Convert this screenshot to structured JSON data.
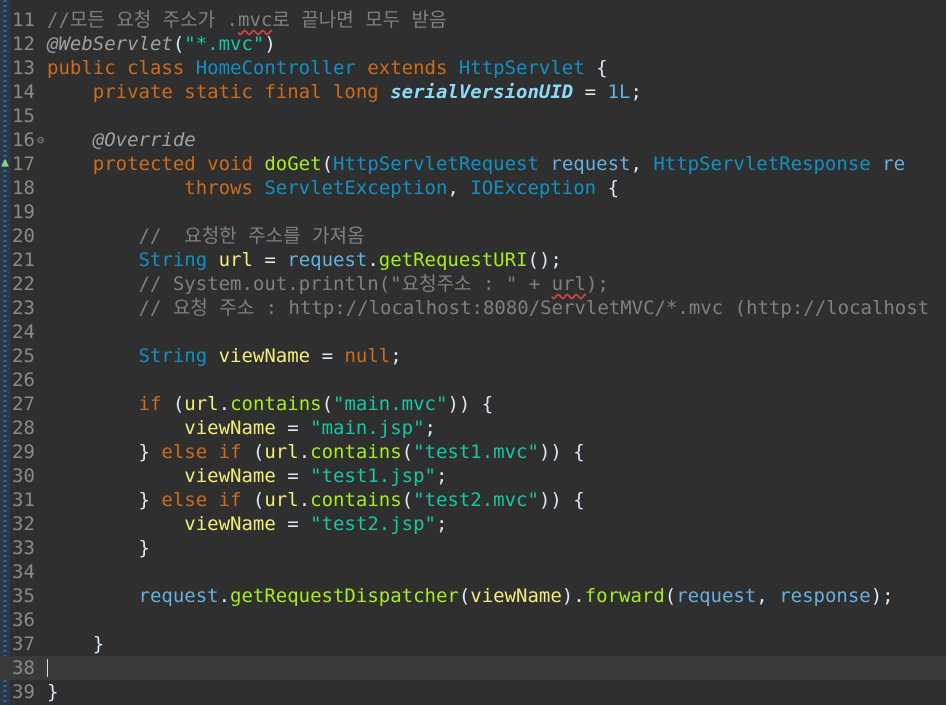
{
  "editor": {
    "lines": [
      {
        "n": "11",
        "tokens": [
          {
            "c": "c",
            "t": "//모든 요청 주소가 ."
          },
          {
            "c": "c sq",
            "t": "mvc"
          },
          {
            "c": "c",
            "t": "로 끝나면 모두 받음"
          }
        ]
      },
      {
        "n": "12",
        "tokens": [
          {
            "c": "an",
            "t": "@WebServlet"
          },
          {
            "c": "w",
            "t": "("
          },
          {
            "c": "s",
            "t": "\"*.mvc\""
          },
          {
            "c": "w",
            "t": ")"
          }
        ]
      },
      {
        "n": "13",
        "tokens": [
          {
            "c": "k",
            "t": "public class "
          },
          {
            "c": "t",
            "t": "HomeController"
          },
          {
            "c": "k",
            "t": " extends "
          },
          {
            "c": "t",
            "t": "HttpServlet"
          },
          {
            "c": "w",
            "t": " {"
          }
        ]
      },
      {
        "n": "14",
        "tokens": [
          {
            "c": "w",
            "t": "    "
          },
          {
            "c": "k",
            "t": "private static final long "
          },
          {
            "c": "fi",
            "t": "serialVersionUID"
          },
          {
            "c": "w",
            "t": " = "
          },
          {
            "c": "p",
            "t": "1L"
          },
          {
            "c": "w",
            "t": ";"
          }
        ]
      },
      {
        "n": "15",
        "tokens": []
      },
      {
        "n": "16",
        "fold": "⊖",
        "tokens": [
          {
            "c": "w",
            "t": "    "
          },
          {
            "c": "an",
            "t": "@Override"
          }
        ]
      },
      {
        "n": "17",
        "tokens": [
          {
            "c": "w",
            "t": "    "
          },
          {
            "c": "k",
            "t": "protected void "
          },
          {
            "c": "m",
            "t": "doGet"
          },
          {
            "c": "w",
            "t": "("
          },
          {
            "c": "t",
            "t": "HttpServletRequest"
          },
          {
            "c": "w",
            "t": " "
          },
          {
            "c": "p",
            "t": "request"
          },
          {
            "c": "w",
            "t": ", "
          },
          {
            "c": "t",
            "t": "HttpServletResponse"
          },
          {
            "c": "w",
            "t": " "
          },
          {
            "c": "p",
            "t": "re"
          }
        ]
      },
      {
        "n": "18",
        "tokens": [
          {
            "c": "w",
            "t": "            "
          },
          {
            "c": "k",
            "t": "throws "
          },
          {
            "c": "t",
            "t": "ServletException"
          },
          {
            "c": "w",
            "t": ", "
          },
          {
            "c": "t",
            "t": "IOException"
          },
          {
            "c": "w",
            "t": " {"
          }
        ]
      },
      {
        "n": "19",
        "tokens": []
      },
      {
        "n": "20",
        "tokens": [
          {
            "c": "c",
            "t": "        //  요청한 주소를 가져옴"
          }
        ]
      },
      {
        "n": "21",
        "tokens": [
          {
            "c": "w",
            "t": "        "
          },
          {
            "c": "t",
            "t": "String"
          },
          {
            "c": "w",
            "t": " "
          },
          {
            "c": "v",
            "t": "url"
          },
          {
            "c": "w",
            "t": " = "
          },
          {
            "c": "p",
            "t": "request"
          },
          {
            "c": "w",
            "t": "."
          },
          {
            "c": "m",
            "t": "getRequestURI"
          },
          {
            "c": "w",
            "t": "();"
          }
        ]
      },
      {
        "n": "22",
        "tokens": [
          {
            "c": "c",
            "t": "        // System.out.println(\"요청주소 : \" + "
          },
          {
            "c": "c sq",
            "t": "url"
          },
          {
            "c": "c",
            "t": ");"
          }
        ]
      },
      {
        "n": "23",
        "tokens": [
          {
            "c": "c",
            "t": "        // 요청 주소 : http://localhost:8080/ServletMVC/*.mvc (http://localhost"
          }
        ]
      },
      {
        "n": "24",
        "tokens": []
      },
      {
        "n": "25",
        "tokens": [
          {
            "c": "w",
            "t": "        "
          },
          {
            "c": "t",
            "t": "String"
          },
          {
            "c": "w",
            "t": " "
          },
          {
            "c": "v",
            "t": "viewName"
          },
          {
            "c": "w",
            "t": " = "
          },
          {
            "c": "k",
            "t": "null"
          },
          {
            "c": "w",
            "t": ";"
          }
        ]
      },
      {
        "n": "26",
        "tokens": []
      },
      {
        "n": "27",
        "tokens": [
          {
            "c": "w",
            "t": "        "
          },
          {
            "c": "k",
            "t": "if"
          },
          {
            "c": "w",
            "t": " ("
          },
          {
            "c": "v",
            "t": "url"
          },
          {
            "c": "w",
            "t": "."
          },
          {
            "c": "m",
            "t": "contains"
          },
          {
            "c": "w",
            "t": "("
          },
          {
            "c": "s",
            "t": "\"main.mvc\""
          },
          {
            "c": "w",
            "t": ")) {"
          }
        ]
      },
      {
        "n": "28",
        "tokens": [
          {
            "c": "w",
            "t": "            "
          },
          {
            "c": "v",
            "t": "viewName"
          },
          {
            "c": "w",
            "t": " = "
          },
          {
            "c": "s",
            "t": "\"main.jsp\""
          },
          {
            "c": "w",
            "t": ";"
          }
        ]
      },
      {
        "n": "29",
        "tokens": [
          {
            "c": "w",
            "t": "        } "
          },
          {
            "c": "k",
            "t": "else if"
          },
          {
            "c": "w",
            "t": " ("
          },
          {
            "c": "v",
            "t": "url"
          },
          {
            "c": "w",
            "t": "."
          },
          {
            "c": "m",
            "t": "contains"
          },
          {
            "c": "w",
            "t": "("
          },
          {
            "c": "s",
            "t": "\"test1.mvc\""
          },
          {
            "c": "w",
            "t": ")) {"
          }
        ]
      },
      {
        "n": "30",
        "tokens": [
          {
            "c": "w",
            "t": "            "
          },
          {
            "c": "v",
            "t": "viewName"
          },
          {
            "c": "w",
            "t": " = "
          },
          {
            "c": "s",
            "t": "\"test1.jsp\""
          },
          {
            "c": "w",
            "t": ";"
          }
        ]
      },
      {
        "n": "31",
        "tokens": [
          {
            "c": "w",
            "t": "        } "
          },
          {
            "c": "k",
            "t": "else if"
          },
          {
            "c": "w",
            "t": " ("
          },
          {
            "c": "v",
            "t": "url"
          },
          {
            "c": "w",
            "t": "."
          },
          {
            "c": "m",
            "t": "contains"
          },
          {
            "c": "w",
            "t": "("
          },
          {
            "c": "s",
            "t": "\"test2.mvc\""
          },
          {
            "c": "w",
            "t": ")) {"
          }
        ]
      },
      {
        "n": "32",
        "tokens": [
          {
            "c": "w",
            "t": "            "
          },
          {
            "c": "v",
            "t": "viewName"
          },
          {
            "c": "w",
            "t": " = "
          },
          {
            "c": "s",
            "t": "\"test2.jsp\""
          },
          {
            "c": "w",
            "t": ";"
          }
        ]
      },
      {
        "n": "33",
        "tokens": [
          {
            "c": "w",
            "t": "        }"
          }
        ]
      },
      {
        "n": "34",
        "tokens": []
      },
      {
        "n": "35",
        "tokens": [
          {
            "c": "w",
            "t": "        "
          },
          {
            "c": "p",
            "t": "request"
          },
          {
            "c": "w",
            "t": "."
          },
          {
            "c": "m",
            "t": "getRequestDispatcher"
          },
          {
            "c": "w",
            "t": "("
          },
          {
            "c": "v",
            "t": "viewName"
          },
          {
            "c": "w",
            "t": ")."
          },
          {
            "c": "m",
            "t": "forward"
          },
          {
            "c": "w",
            "t": "("
          },
          {
            "c": "p",
            "t": "request"
          },
          {
            "c": "w",
            "t": ", "
          },
          {
            "c": "p",
            "t": "response"
          },
          {
            "c": "w",
            "t": ");"
          }
        ]
      },
      {
        "n": "36",
        "tokens": []
      },
      {
        "n": "37",
        "tokens": [
          {
            "c": "w",
            "t": "    }"
          }
        ]
      },
      {
        "n": "38",
        "current": true,
        "tokens": []
      },
      {
        "n": "39",
        "tokens": [
          {
            "c": "w",
            "t": "}"
          }
        ]
      }
    ]
  }
}
